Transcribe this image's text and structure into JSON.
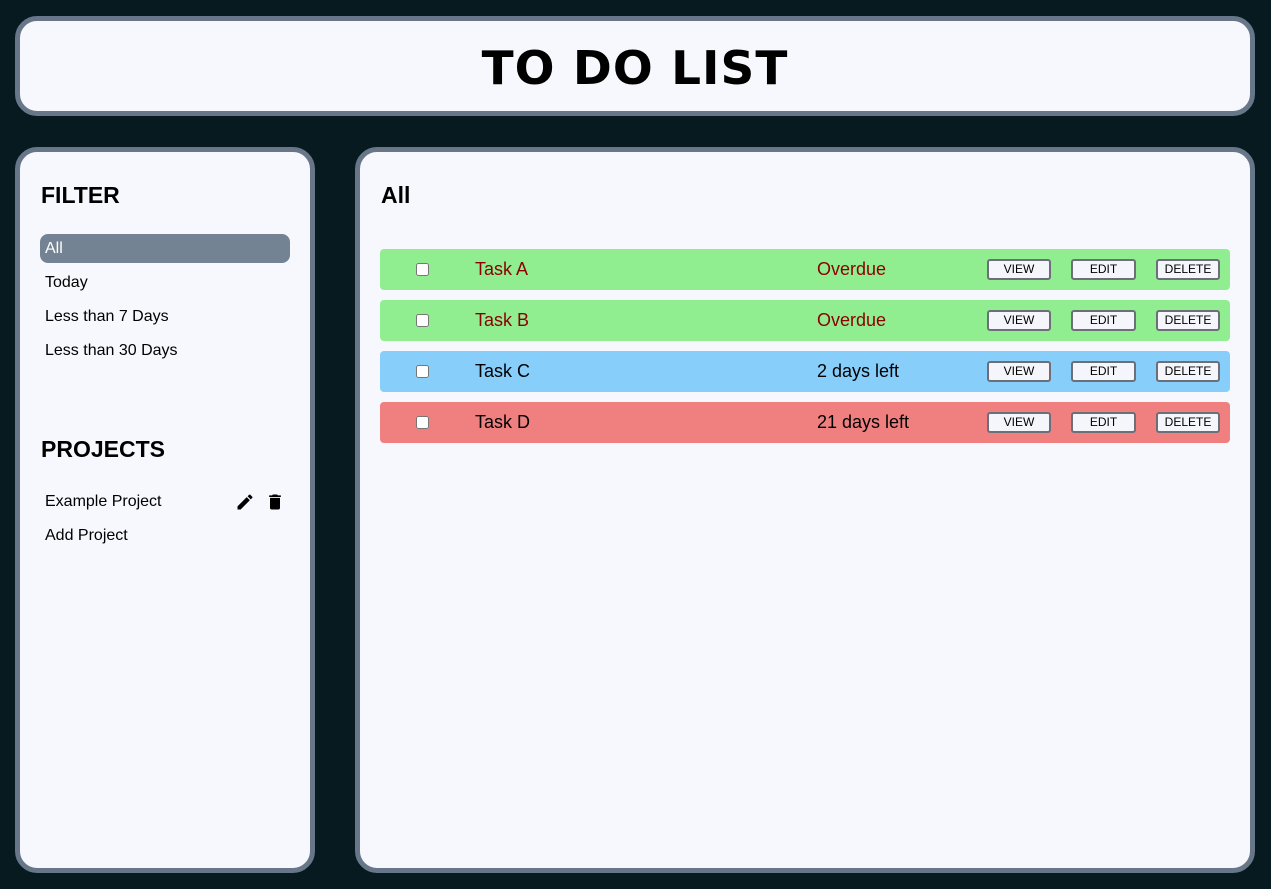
{
  "header": {
    "title": "TO DO LIST"
  },
  "sidebar": {
    "filter_title": "FILTER",
    "filters": [
      {
        "label": "All",
        "active": true
      },
      {
        "label": "Today",
        "active": false
      },
      {
        "label": "Less than 7 Days",
        "active": false
      },
      {
        "label": "Less than 30 Days",
        "active": false
      }
    ],
    "projects_title": "PROJECTS",
    "projects": [
      {
        "label": "Example Project",
        "icons": [
          "pencil-icon",
          "trash-icon"
        ]
      }
    ],
    "add_project_label": "Add Project"
  },
  "main": {
    "title": "All",
    "tasks": [
      {
        "title": "Task A",
        "due": "Overdue",
        "row_color": "#90ee90",
        "text_color": "#8b0000",
        "checked": false
      },
      {
        "title": "Task B",
        "due": "Overdue",
        "row_color": "#90ee90",
        "text_color": "#8b0000",
        "checked": false
      },
      {
        "title": "Task C",
        "due": "2 days left",
        "row_color": "#87cefa",
        "text_color": "#000000",
        "checked": false
      },
      {
        "title": "Task D",
        "due": "21 days left",
        "row_color": "#f08080",
        "text_color": "#000000",
        "checked": false
      }
    ],
    "buttons": {
      "view": "VIEW",
      "edit": "EDIT",
      "delete": "DELETE"
    }
  },
  "colors": {
    "background": "#061a1f",
    "panel": "#f7f8fd",
    "panel_border": "#677789",
    "active_filter": "#748394"
  }
}
